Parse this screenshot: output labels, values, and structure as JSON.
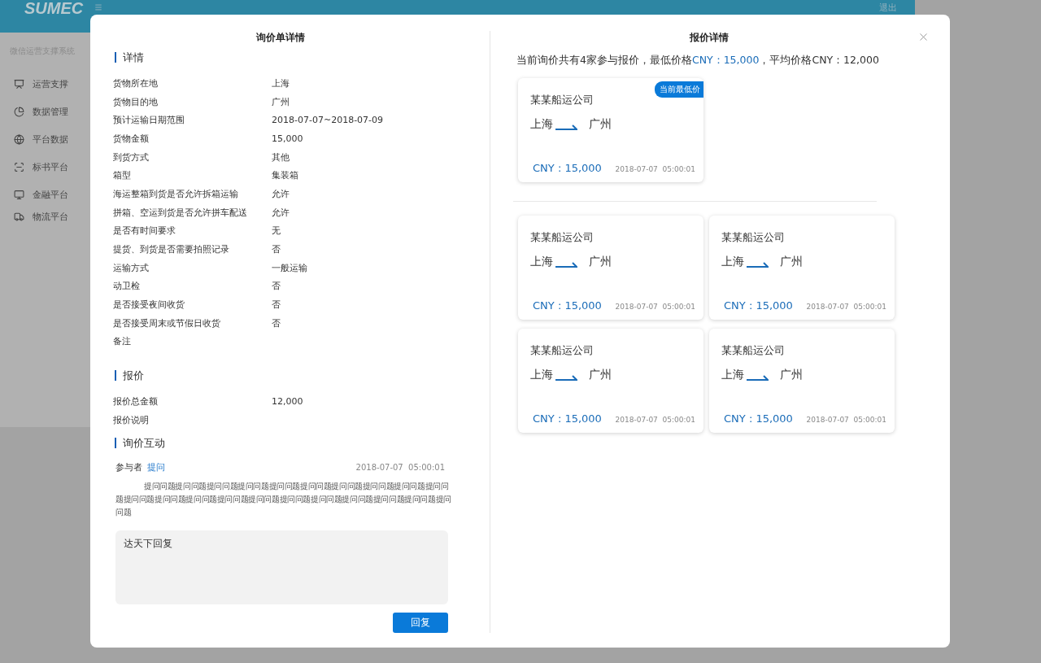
{
  "app": {
    "logo": "SUMEC",
    "logout": "退出",
    "system_name": "微信运营支撑系统",
    "sidebar": [
      {
        "label": "运营支撑"
      },
      {
        "label": "数据管理"
      },
      {
        "label": "平台数据"
      },
      {
        "label": "标书平台"
      },
      {
        "label": "金融平台"
      },
      {
        "label": "物流平台"
      }
    ]
  },
  "dialog": {
    "inquiry": {
      "title": "询价单详情",
      "sections": [
        {
          "heading": "详情",
          "rows": [
            {
              "label": "货物所在地",
              "value": "上海"
            },
            {
              "label": "货物目的地",
              "value": "广州"
            },
            {
              "label": "预计运输日期范围",
              "value": "2018-07-07~2018-07-09"
            },
            {
              "label": "货物金额",
              "value": "15,000"
            },
            {
              "label": "到货方式",
              "value": "其他"
            },
            {
              "label": "箱型",
              "value": "集装箱"
            },
            {
              "label": "海运整箱到货是否允许拆箱运输",
              "value": "允许"
            },
            {
              "label": "拼箱、空运到货是否允许拼车配送",
              "value": "允许"
            },
            {
              "label": "是否有时间要求",
              "value": "无"
            },
            {
              "label": "提货、到货是否需要拍照记录",
              "value": "否"
            },
            {
              "label": "运输方式",
              "value": "一般运输"
            },
            {
              "label": "动卫检",
              "value": "否"
            },
            {
              "label": "是否接受夜间收货",
              "value": "否"
            },
            {
              "label": "是否接受周末或节假日收货",
              "value": "否"
            },
            {
              "label": "备注"
            }
          ]
        },
        {
          "heading": "报价",
          "rows": [
            {
              "label": "报价总金额",
              "value": "12,000"
            },
            {
              "label": "报价说明"
            }
          ]
        }
      ],
      "interaction": {
        "heading": "询价互动",
        "author": "参与者",
        "link": "提问",
        "time": "2018-07-07  05:00:01",
        "message": "提问问题提问问题提问问题提问问题提问问题提问问题提问问题提问问题提问问题提问问题提问问题提问问题提问问题提问问题提问问题提问问题提问问题提问问题提问问题提问问题提问问题",
        "reply": {
          "value": "达天下回复"
        },
        "button": "回复"
      }
    },
    "quotes": {
      "title": "报价详情",
      "summary": {
        "before": "当前询价共有4家参与报价，最低价格",
        "highlight": "CNY：15,000",
        "after": "，平均价格CNY：12,000"
      },
      "groups": [
        {
          "cards": [
            {
              "company": "某某船运公司",
              "from": "上海",
              "to": "广州",
              "price": "CNY : 15,000",
              "time": "2018-07-07  05:00:01",
              "badge": "当前最低价"
            }
          ]
        },
        {
          "cards": [
            {
              "company": "某某船运公司",
              "from": "上海",
              "to": "广州",
              "price": "CNY : 15,000",
              "time": "2018-07-07  05:00:01"
            },
            {
              "company": "某某船运公司",
              "from": "上海",
              "to": "广州",
              "price": "CNY : 15,000",
              "time": "2018-07-07  05:00:01"
            },
            {
              "company": "某某船运公司",
              "from": "上海",
              "to": "广州",
              "price": "CNY : 15,000",
              "time": "2018-07-07  05:00:01"
            },
            {
              "company": "某某船运公司",
              "from": "上海",
              "to": "广州",
              "price": "CNY : 15,000",
              "time": "2018-07-07  05:00:01"
            }
          ]
        }
      ]
    }
  }
}
